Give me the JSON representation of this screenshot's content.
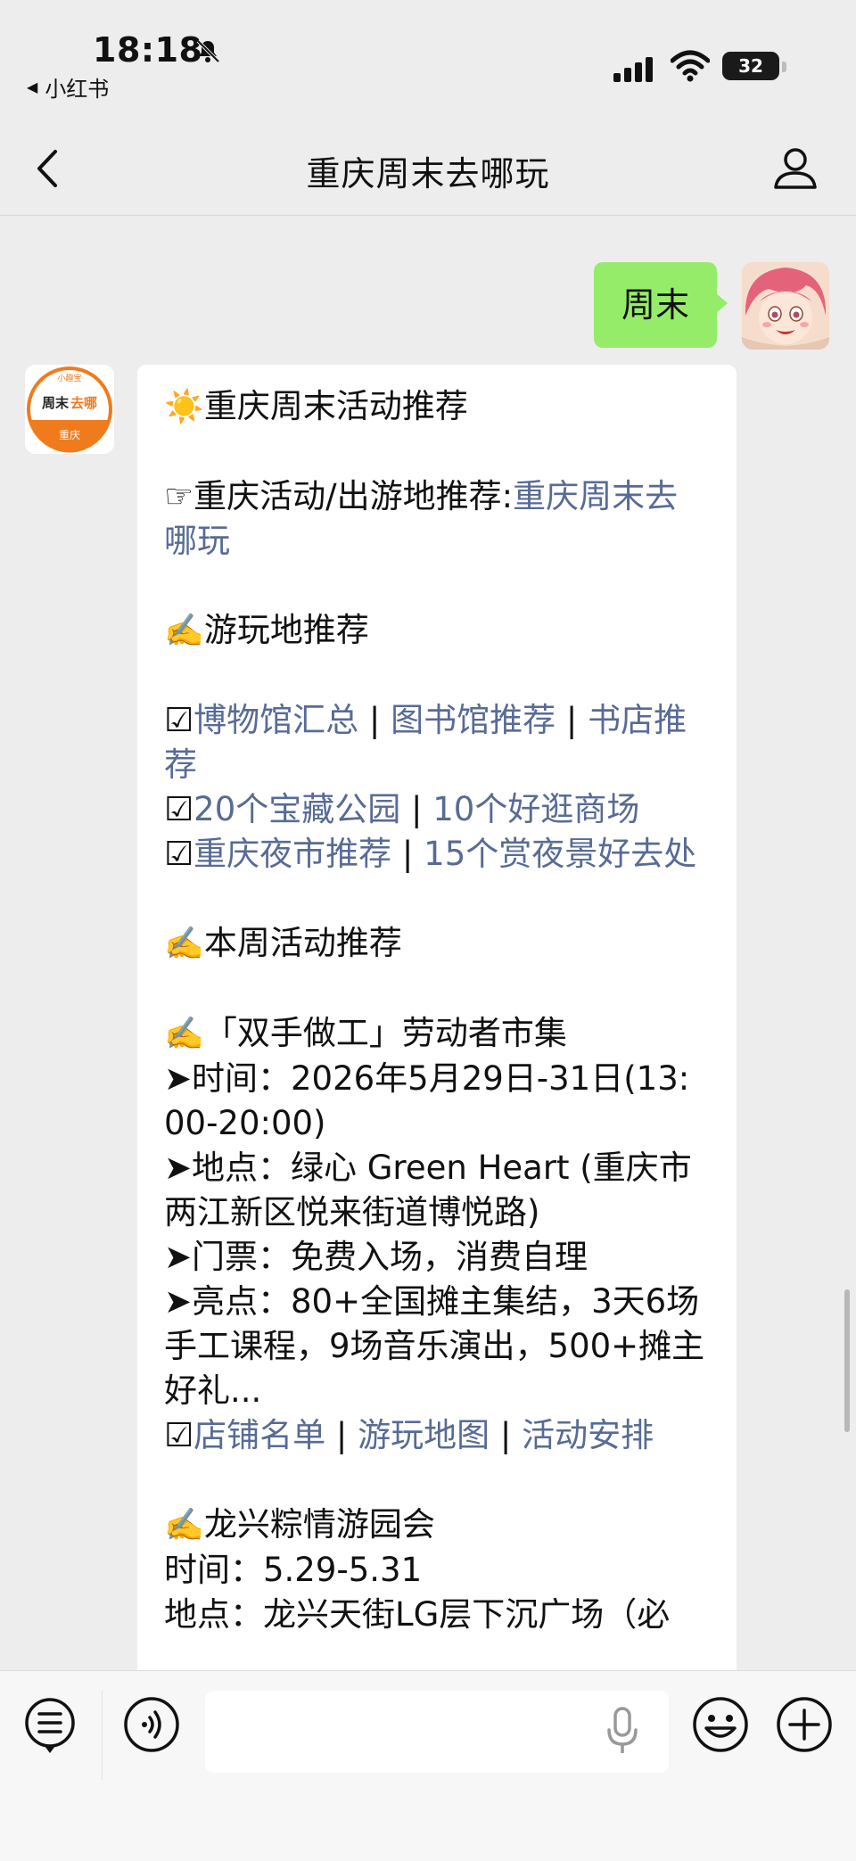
{
  "status_bar": {
    "time": "18:18",
    "back_app": "小红书",
    "battery": "32",
    "icons": [
      "bell-muted-icon",
      "signal-icon",
      "wifi-icon",
      "battery-icon"
    ]
  },
  "nav": {
    "title": "重庆周末去哪玩",
    "icons": [
      "chevron-left-icon",
      "profile-icon"
    ]
  },
  "chat": {
    "outgoing_message": "周末",
    "bot_avatar": {
      "top_text": "小趣宝",
      "main_text_a": "周末",
      "main_text_b": "去哪",
      "bottom_text": "重庆"
    },
    "incoming": {
      "title": "重庆周末活动推荐",
      "rec_prefix": "☞重庆活动/出游地推荐:",
      "rec_link": "重庆周末去哪玩",
      "section1_heading": "游玩地推荐",
      "line1_links": [
        "博物馆汇总",
        "图书馆推荐",
        "书店推荐"
      ],
      "line2_links": [
        "20个宝藏公园",
        "10个好逛商场"
      ],
      "line3_links": [
        "重庆夜市推荐",
        "15个赏夜景好去处"
      ],
      "section2_heading": "本周活动推荐",
      "event1": {
        "title": "「双手做工」劳动者市集",
        "time": "➤时间：2026年5月29日-31日(13:00-20:00)",
        "place": "➤地点：绿心 Green Heart (重庆市两江新区悦来街道博悦路)",
        "ticket": "➤门票：免费入场，消费自理",
        "highlight": "➤亮点：80+全国摊主集结，3天6场手工课程，9场音乐演出，500+摊主好礼...",
        "links": [
          "店铺名单",
          "游玩地图",
          "活动安排"
        ]
      },
      "event2": {
        "title": "龙兴粽情游园会",
        "time": "时间：5.29-5.31",
        "place": "地点：龙兴天街LG层下沉广场（必"
      }
    }
  },
  "input_bar": {
    "icons": [
      "menu-list-icon",
      "voice-icon",
      "microphone-icon",
      "emoji-icon",
      "plus-icon"
    ]
  },
  "colors": {
    "background": "#ededed",
    "outgoing_bubble": "#95ec69",
    "link": "#576b95",
    "bot_avatar_orange": "#f07b1c"
  }
}
